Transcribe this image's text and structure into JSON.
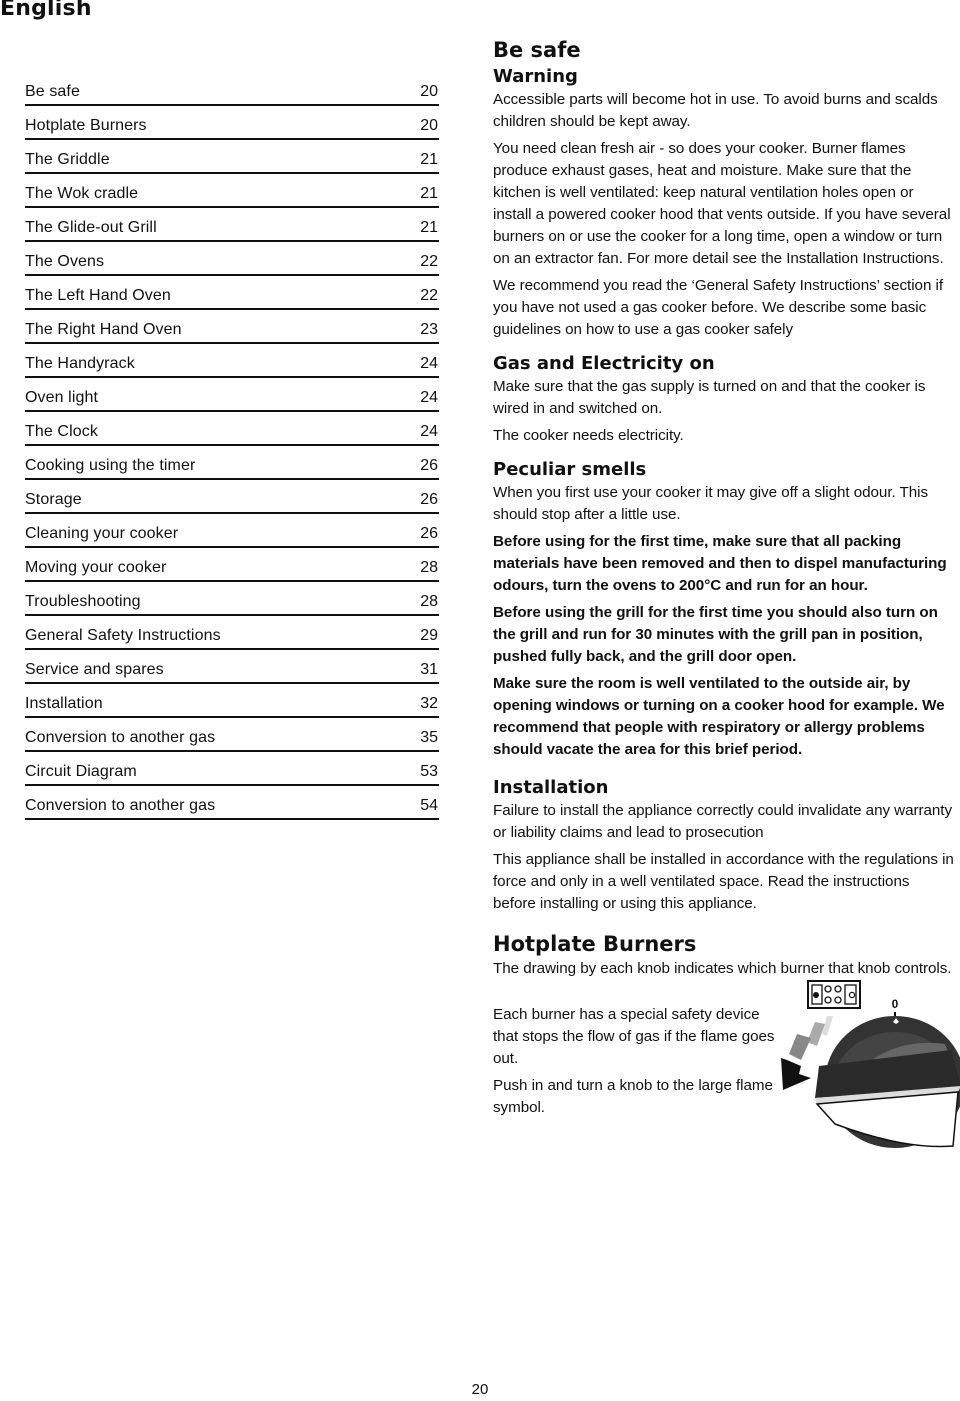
{
  "page": {
    "language_heading": "English",
    "page_number": "20"
  },
  "toc": [
    {
      "title": "Be safe",
      "page": "20"
    },
    {
      "title": "Hotplate Burners",
      "page": "20"
    },
    {
      "title": "The Griddle",
      "page": "21"
    },
    {
      "title": "The Wok cradle",
      "page": "21"
    },
    {
      "title": "The Glide-out Grill",
      "page": "21"
    },
    {
      "title": "The Ovens",
      "page": "22"
    },
    {
      "title": "The Left Hand Oven",
      "page": "22"
    },
    {
      "title": "The Right Hand Oven",
      "page": "23"
    },
    {
      "title": "The Handyrack",
      "page": "24"
    },
    {
      "title": "Oven light",
      "page": "24"
    },
    {
      "title": "The Clock",
      "page": "24"
    },
    {
      "title": "Cooking using the timer",
      "page": "26"
    },
    {
      "title": "Storage",
      "page": "26"
    },
    {
      "title": "Cleaning your cooker",
      "page": "26"
    },
    {
      "title": "Moving your cooker",
      "page": "28"
    },
    {
      "title": "Troubleshooting",
      "page": "28"
    },
    {
      "title": "General Safety Instructions",
      "page": "29"
    },
    {
      "title": "Service and spares",
      "page": "31"
    },
    {
      "title": "Installation",
      "page": "32"
    },
    {
      "title": "Conversion to another gas",
      "page": "35"
    },
    {
      "title": "Circuit Diagram",
      "page": "53"
    },
    {
      "title": "Conversion to another gas",
      "page": "54"
    }
  ],
  "content": {
    "be_safe": {
      "heading": "Be safe",
      "warning_heading": "Warning",
      "paragraphs": [
        "Accessible parts will become hot in use. To avoid burns and scalds children should be kept away.",
        "You need clean fresh air - so does your cooker. Burner flames produce exhaust gases, heat and moisture. Make sure that the kitchen is well ventilated: keep natural ventilation holes open or install a powered cooker hood that vents outside. If you have several burners on or use the cooker for a long time, open a window or turn on an extractor fan. For more detail see the Installation Instructions.",
        "We recommend you read the ‘General Safety Instructions’ section if you have not used a gas cooker before. We describe some basic guidelines on how to use a gas cooker safely"
      ]
    },
    "gas_electricity": {
      "heading": "Gas and Electricity on",
      "paragraphs": [
        "Make sure that the gas supply is turned on and that the cooker is wired in and switched on.",
        "The cooker needs electricity."
      ]
    },
    "peculiar_smells": {
      "heading": "Peculiar smells",
      "paragraphs": [
        "When you first use your cooker it may give off a slight odour. This should stop after a little use."
      ],
      "bold_paragraphs": [
        "Before using for the first time, make sure that all packing materials have been removed and then to dispel manufacturing odours, turn the ovens to 200°C and run for an hour.",
        "Before using the grill for the first time you should also turn on the grill and run for 30 minutes with the grill pan in position, pushed fully back, and the grill door open.",
        "Make sure the room is well ventilated to the outside air, by opening windows or turning on a cooker hood for example. We recommend that people with respiratory or allergy problems should vacate the area for this brief period."
      ]
    },
    "installation": {
      "heading": "Installation",
      "paragraphs": [
        "Failure to install the appliance correctly could invalidate any warranty or liability claims and lead to prosecution",
        "This appliance shall be installed in accordance with the regulations in force and only in a well ventilated space. Read the instructions before installing or using this appliance."
      ]
    },
    "hotplate_burners": {
      "heading": "Hotplate Burners",
      "intro": "The drawing by each knob indicates which burner that knob controls.",
      "paragraphs": [
        "Each burner has a special safety device that stops the flow of gas if the flame goes out.",
        "Push in and turn a knob to the large flame symbol."
      ],
      "figure": {
        "knob_zero_label": "0",
        "icons": [
          "burner-layout-icon",
          "knob-icon",
          "turn-arrow-icon"
        ]
      }
    }
  }
}
